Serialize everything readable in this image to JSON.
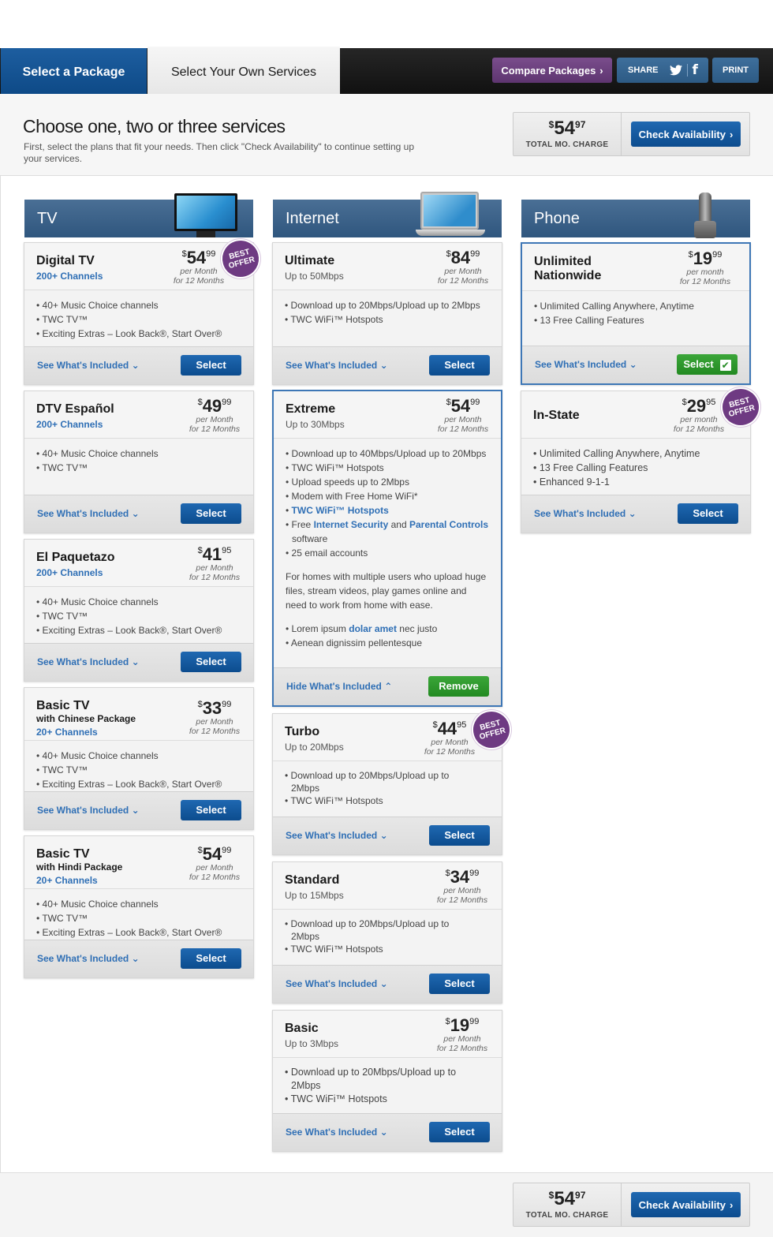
{
  "nav": {
    "tab_active": "Select a Package",
    "tab_inactive": "Select Your Own Services",
    "compare": "Compare Packages",
    "share": "SHARE",
    "print": "PRINT"
  },
  "header": {
    "title": "Choose one, two or three services",
    "subtitle": "First, select the plans that fit your needs. Then click \"Check Availability\" to continue setting up your services."
  },
  "total": {
    "dollar": "$",
    "price": "54",
    "cents": "97",
    "label": "TOTAL MO. CHARGE",
    "check": "Check Availability"
  },
  "common": {
    "see": "See What's Included",
    "hide": "Hide What's Included",
    "select": "Select",
    "remove": "Remove",
    "badge": "BEST OFFER",
    "per_month": "per Month",
    "per_month_lc": "per month",
    "for12": "for 12 Months"
  },
  "columns": {
    "tv": "TV",
    "internet": "Internet",
    "phone": "Phone"
  },
  "tv": [
    {
      "name": "Digital TV",
      "sub": "200+ Channels",
      "price": "54",
      "cents": "99",
      "features": [
        "40+ Music Choice channels",
        "TWC TV™",
        "Exciting Extras – Look Back®, Start Over®"
      ]
    },
    {
      "name": "DTV Español",
      "sub": "200+ Channels",
      "price": "49",
      "cents": "99",
      "features": [
        "40+ Music Choice channels",
        "TWC TV™"
      ]
    },
    {
      "name": "El Paquetazo",
      "sub": "200+ Channels",
      "price": "41",
      "cents": "95",
      "features": [
        "40+ Music Choice channels",
        "TWC TV™",
        "Exciting Extras – Look Back®, Start Over®"
      ]
    },
    {
      "name": "Basic TV",
      "name2": "with Chinese Package",
      "sub": "20+ Channels",
      "price": "33",
      "cents": "99",
      "features": [
        "40+ Music Choice channels",
        "TWC TV™",
        "Exciting Extras – Look Back®, Start Over®"
      ]
    },
    {
      "name": "Basic TV",
      "name2": "with Hindi Package",
      "sub": "20+ Channels",
      "price": "54",
      "cents": "99",
      "features": [
        "40+ Music Choice channels",
        "TWC TV™",
        "Exciting Extras – Look Back®, Start Over®"
      ]
    }
  ],
  "internet": [
    {
      "name": "Ultimate",
      "sub": "Up to 50Mbps",
      "price": "84",
      "cents": "99",
      "features": [
        "Download up to 20Mbps/Upload up to 2Mbps",
        "TWC WiFi™ Hotspots"
      ]
    },
    {
      "name": "Extreme",
      "sub": "Up to 30Mbps",
      "price": "54",
      "cents": "99",
      "features": [
        "Download up to 40Mbps/Upload up to 20Mbps",
        "TWC WiFi™ Hotspots",
        "Upload speeds up to 2Mbps",
        "Modem with Free Home WiFi*"
      ],
      "f5": "TWC WiFi™ Hotspots",
      "f6a": "Free ",
      "f6b": "Internet Security",
      "f6c": " and ",
      "f6d": "Parental Controls",
      "f6e": " software",
      "f7": "25 email accounts",
      "para": "For homes with multiple users who upload huge files, stream videos, play games online and need to work from home with ease.",
      "l1a": "Lorem ipsum ",
      "l1b": "dolar amet",
      "l1c": " nec justo",
      "l2": "Aenean dignissim pellentesque"
    },
    {
      "name": "Turbo",
      "sub": "Up to 20Mbps",
      "price": "44",
      "cents": "95",
      "features": [
        "Download up to 20Mbps/Upload up to 2Mbps",
        "TWC WiFi™ Hotspots"
      ]
    },
    {
      "name": "Standard",
      "sub": "Up to 15Mbps",
      "price": "34",
      "cents": "99",
      "features": [
        "Download up to 20Mbps/Upload up to 2Mbps",
        "TWC WiFi™ Hotspots"
      ]
    },
    {
      "name": "Basic",
      "sub": "Up to 3Mbps",
      "price": "19",
      "cents": "99",
      "features": [
        "Download up to 20Mbps/Upload up to 2Mbps",
        "TWC WiFi™ Hotspots"
      ]
    }
  ],
  "phone": [
    {
      "name": "Unlimited",
      "name2": "Nationwide",
      "price": "19",
      "cents": "99",
      "features": [
        "Unlimited Calling Anywhere, Anytime",
        "13 Free Calling Features"
      ]
    },
    {
      "name": "In-State",
      "price": "29",
      "cents": "95",
      "features": [
        "Unlimited Calling Anywhere, Anytime",
        "13 Free Calling Features",
        "Enhanced 9-1-1"
      ]
    }
  ]
}
